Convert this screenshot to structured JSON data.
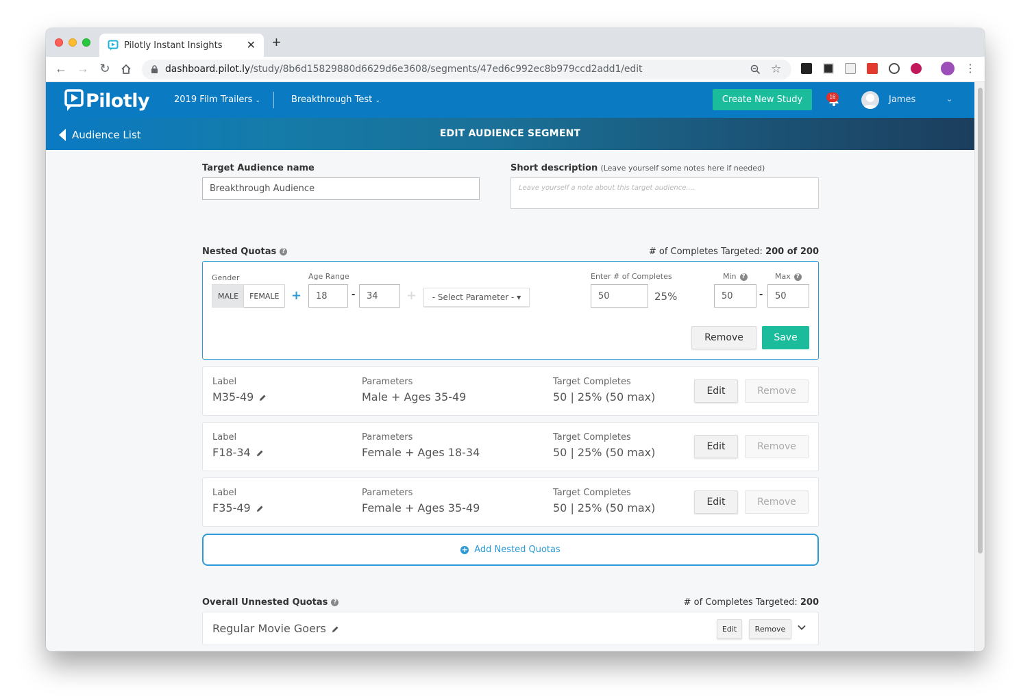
{
  "browser": {
    "tab_title": "Pilotly Instant Insights",
    "tab_close": "✕",
    "new_tab": "+",
    "url_host": "dashboard.pilot.ly",
    "url_path": "/study/8b6d15829880d6629d6e3608/segments/47ed6c992ec8b979ccd2add1/edit"
  },
  "header": {
    "logo_text": "Pilotly",
    "study_dropdown": "2019 Film Trailers",
    "test_dropdown": "Breakthrough Test",
    "create_button": "Create New Study",
    "notification_count": "16",
    "user_name": "James"
  },
  "subheader": {
    "back_label": "Audience List",
    "title": "EDIT AUDIENCE SEGMENT"
  },
  "form": {
    "name_label": "Target Audience name",
    "name_value": "Breakthrough Audience",
    "desc_label": "Short description",
    "desc_hint": "(Leave yourself some notes here if needed)",
    "desc_placeholder": "Leave yourself a note about this target audience...."
  },
  "nested": {
    "title": "Nested Quotas",
    "completes_prefix": "# of Completes Targeted:",
    "completes_value": "200 of 200",
    "editor": {
      "gender_label": "Gender",
      "gender_options": [
        "MALE",
        "FEMALE"
      ],
      "gender_selected": "MALE",
      "age_label": "Age Range",
      "age_min": "18",
      "age_max": "34",
      "select_param": "- Select Parameter -",
      "completes_label": "Enter # of Completes",
      "completes_value": "50",
      "percent": "25%",
      "min_label": "Min",
      "max_label": "Max",
      "min_value": "50",
      "max_value": "50",
      "remove": "Remove",
      "save": "Save"
    },
    "rows": [
      {
        "label_caption": "Label",
        "label": "M35-49",
        "params_caption": "Parameters",
        "params": "Male + Ages 35-49",
        "target_caption": "Target Completes",
        "target": "50 | 25% (50 max)",
        "edit": "Edit",
        "remove": "Remove"
      },
      {
        "label_caption": "Label",
        "label": "F18-34",
        "params_caption": "Parameters",
        "params": "Female + Ages 18-34",
        "target_caption": "Target Completes",
        "target": "50 | 25% (50 max)",
        "edit": "Edit",
        "remove": "Remove"
      },
      {
        "label_caption": "Label",
        "label": "F35-49",
        "params_caption": "Parameters",
        "params": "Female + Ages 35-49",
        "target_caption": "Target Completes",
        "target": "50 | 25% (50 max)",
        "edit": "Edit",
        "remove": "Remove"
      }
    ],
    "add_button": "Add Nested Quotas"
  },
  "unnested": {
    "title": "Overall Unnested Quotas",
    "completes_prefix": "# of Completes Targeted:",
    "completes_value": "200",
    "row_label": "Regular Movie Goers",
    "edit": "Edit",
    "remove": "Remove"
  },
  "colors": {
    "brand_blue": "#0a7ac3",
    "accent_teal": "#1abc9c",
    "link_blue": "#2c9ad6"
  }
}
